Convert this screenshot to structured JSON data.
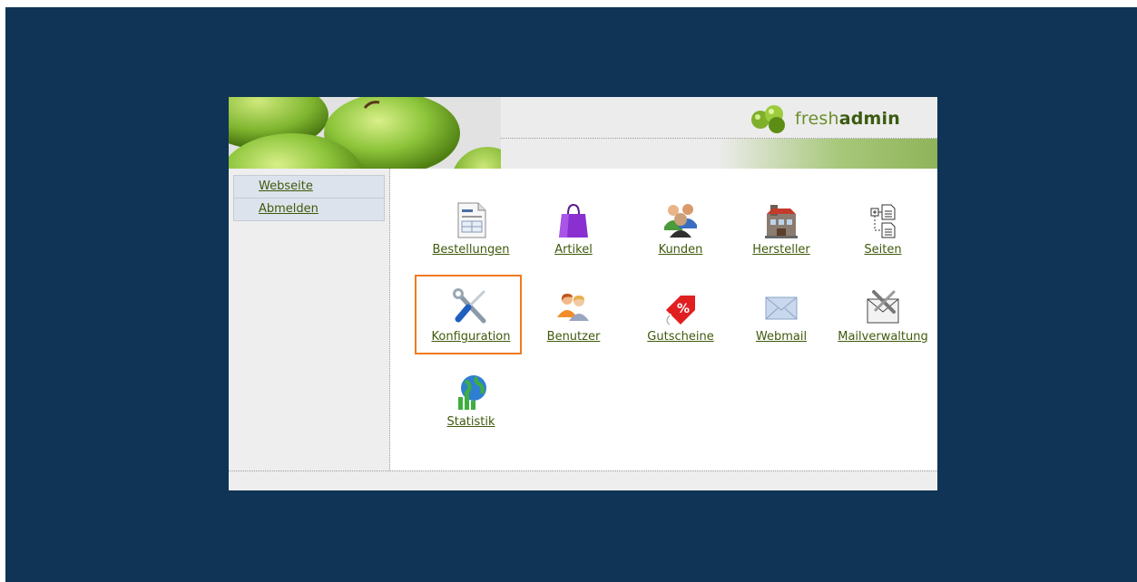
{
  "app": {
    "logo_light": "fresh",
    "logo_bold": "admin"
  },
  "sidebar": {
    "items": [
      {
        "label": "Webseite"
      },
      {
        "label": "Abmelden"
      }
    ]
  },
  "tiles": [
    {
      "label": "Bestellungen",
      "icon": "orders-document-icon"
    },
    {
      "label": "Artikel",
      "icon": "shopping-bag-icon"
    },
    {
      "label": "Kunden",
      "icon": "customers-people-icon"
    },
    {
      "label": "Hersteller",
      "icon": "manufacturer-building-icon"
    },
    {
      "label": "Seiten",
      "icon": "pages-tree-icon"
    },
    {
      "label": "Konfiguration",
      "icon": "tools-wrench-screwdriver-icon"
    },
    {
      "label": "Benutzer",
      "icon": "users-icon"
    },
    {
      "label": "Gutscheine",
      "icon": "coupon-tag-icon"
    },
    {
      "label": "Webmail",
      "icon": "mail-envelope-icon"
    },
    {
      "label": "Mailverwaltung",
      "icon": "mail-settings-icon"
    },
    {
      "label": "Statistik",
      "icon": "statistics-chart-globe-icon"
    }
  ],
  "colors": {
    "background": "#0f3455",
    "link": "#3f5a0b",
    "highlight": "#f07a20",
    "accent_green": "#6d8f2e"
  }
}
